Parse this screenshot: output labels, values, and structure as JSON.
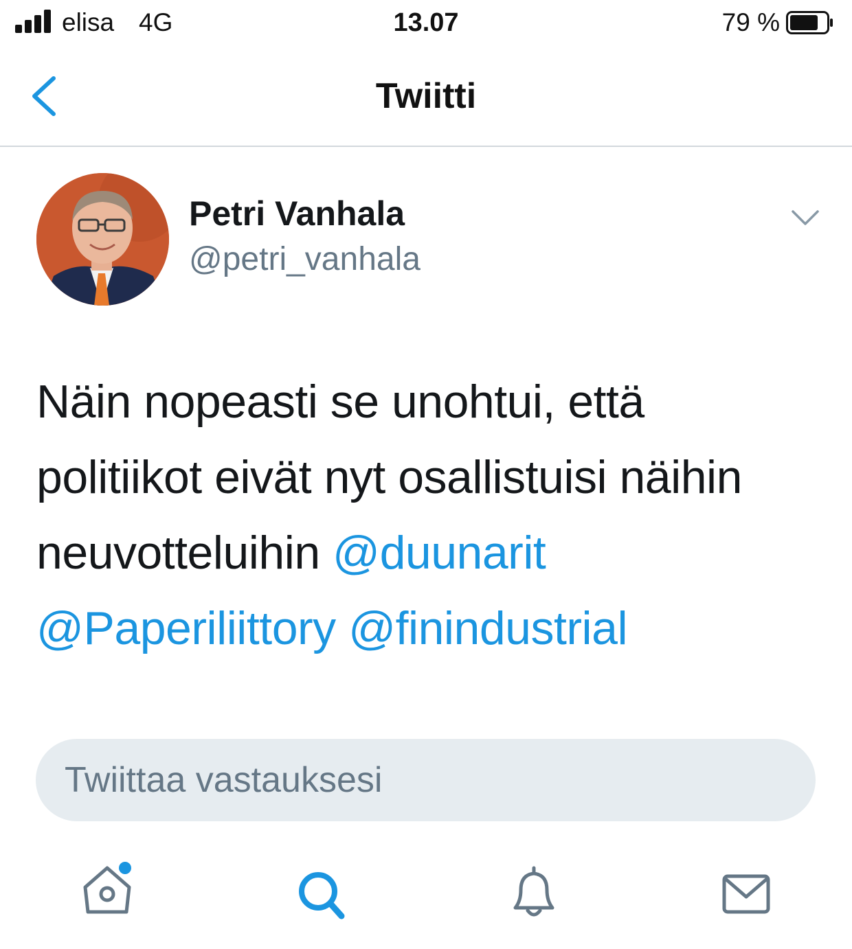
{
  "status_bar": {
    "carrier": "elisa",
    "network": "4G",
    "time": "13.07",
    "battery_percent": "79 %",
    "battery_level": 0.79,
    "signal_bars": 4
  },
  "header": {
    "title": "Twiitti",
    "back_icon": "chevron-left-icon"
  },
  "tweet": {
    "author": {
      "display_name": "Petri Vanhala",
      "handle": "@petri_vanhala"
    },
    "text_plain": "Näin nopeasti se unohtui, että politiikot eivät nyt osallistuisi näihin neuvotteluihin ",
    "mentions": [
      "@duunarit",
      "@Paperiliittory",
      "@finindustrial"
    ]
  },
  "reply": {
    "placeholder": "Twiittaa vastauksesi"
  },
  "tab_bar": {
    "items": [
      {
        "name": "home",
        "icon": "home-icon",
        "has_notification_dot": true
      },
      {
        "name": "search",
        "icon": "search-icon",
        "active": true
      },
      {
        "name": "notifications",
        "icon": "bell-icon"
      },
      {
        "name": "messages",
        "icon": "mail-icon"
      }
    ]
  },
  "colors": {
    "accent": "#1b95e0",
    "text": "#14171a",
    "secondary_text": "#657786",
    "reply_background": "#e6ecf0"
  }
}
